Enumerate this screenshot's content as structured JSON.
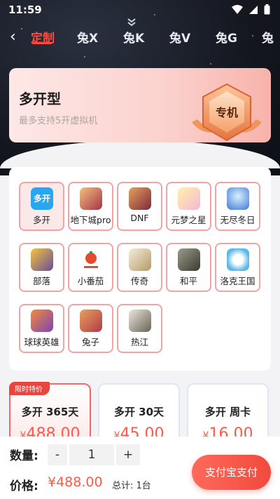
{
  "status_bar": {
    "time": "11:59"
  },
  "tabs": [
    {
      "label": "定制",
      "active": true
    },
    {
      "label": "兔X"
    },
    {
      "label": "兔K"
    },
    {
      "label": "兔V"
    },
    {
      "label": "兔G"
    },
    {
      "label": "兔"
    }
  ],
  "banner": {
    "title": "多开型",
    "subtitle": "最多支持5开虚拟机",
    "badge": "专机"
  },
  "apps": [
    {
      "label": "多开",
      "icon_text": "多开",
      "color": "#27a6f2"
    },
    {
      "label": "地下城pro",
      "color": "#a8324a"
    },
    {
      "label": "DNF",
      "color": "#7b2a3c"
    },
    {
      "label": "元梦之星",
      "color": "#f6b7d5"
    },
    {
      "label": "无尽冬日",
      "color": "#3f78d4"
    },
    {
      "label": "部落",
      "color": "#6a4d9a"
    },
    {
      "label": "小番茄",
      "color": "#e64a2e"
    },
    {
      "label": "传奇",
      "color": "#d8c6a0"
    },
    {
      "label": "和平",
      "color": "#5c5a48"
    },
    {
      "label": "洛克王国",
      "color": "#5cb8e8"
    },
    {
      "label": "球球英雄",
      "color": "#7a45b8"
    },
    {
      "label": "兔子",
      "color": "#b23a4c"
    },
    {
      "label": "热江",
      "color": "#c9c3b5"
    }
  ],
  "plans": [
    {
      "tag": "限时特价",
      "name": "多开 365天",
      "currency": "¥",
      "price": "488.00"
    },
    {
      "name": "多开 30天",
      "currency": "¥",
      "price": "45.00"
    },
    {
      "name": "多开 周卡",
      "currency": "¥",
      "price": "16.00"
    }
  ],
  "bottom": {
    "qty_label": "数量:",
    "minus": "-",
    "quantity": "1",
    "plus": "+",
    "price_label": "价格:",
    "price_value": "¥488.00",
    "total_text": "总计: 1台",
    "pay_button": "支付宝支付"
  },
  "colors": {
    "accent": "#ff4a3d",
    "price": "#ff5a48"
  }
}
